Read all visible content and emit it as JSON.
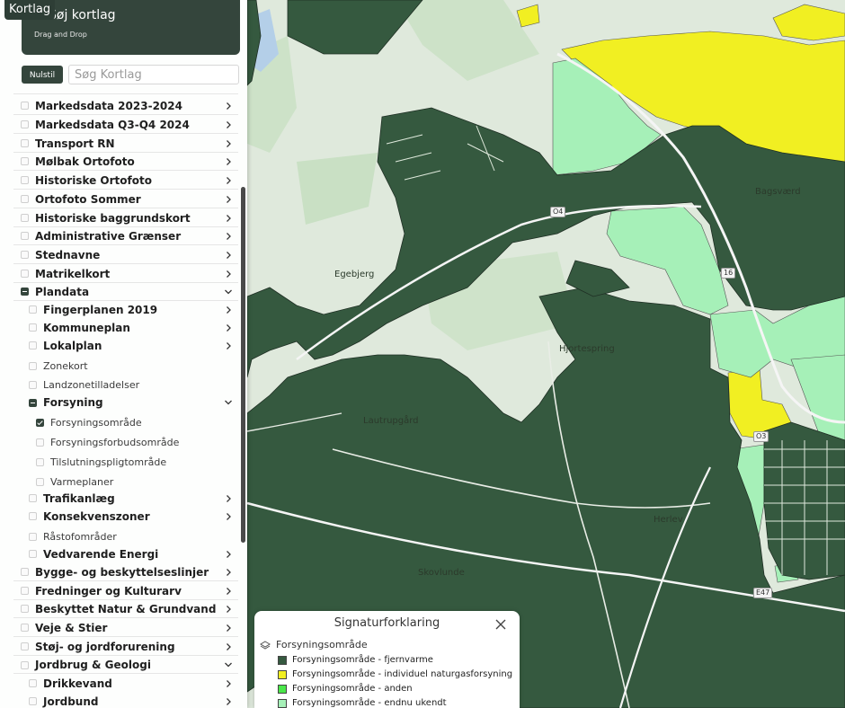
{
  "sidebar": {
    "tab_label": "Kortlag",
    "drop_title": "Søj kortlag",
    "drop_subtitle": "Drag and Drop",
    "reset_label": "Nulstil",
    "search_placeholder": "Søg Kortlag",
    "items": [
      {
        "label": "Markedsdata 2023-2024",
        "level": 1,
        "state": "unchecked",
        "chevron": "right"
      },
      {
        "label": "Markedsdata Q3-Q4 2024",
        "level": 1,
        "state": "unchecked",
        "chevron": "right"
      },
      {
        "label": "Transport RN",
        "level": 1,
        "state": "unchecked",
        "chevron": "right"
      },
      {
        "label": "Mølbak Ortofoto",
        "level": 1,
        "state": "unchecked",
        "chevron": "right"
      },
      {
        "label": "Historiske Ortofoto",
        "level": 1,
        "state": "unchecked",
        "chevron": "right"
      },
      {
        "label": "Ortofoto Sommer",
        "level": 1,
        "state": "unchecked",
        "chevron": "right"
      },
      {
        "label": "Historiske baggrundskort",
        "level": 1,
        "state": "unchecked",
        "chevron": "right"
      },
      {
        "label": "Administrative Grænser",
        "level": 1,
        "state": "unchecked",
        "chevron": "right"
      },
      {
        "label": "Stednavne",
        "level": 1,
        "state": "unchecked",
        "chevron": "right"
      },
      {
        "label": "Matrikelkort",
        "level": 1,
        "state": "unchecked",
        "chevron": "right"
      },
      {
        "label": "Plandata",
        "level": 1,
        "state": "partial",
        "chevron": "down"
      },
      {
        "label": "Fingerplanen 2019",
        "level": 2,
        "state": "unchecked",
        "chevron": "right"
      },
      {
        "label": "Kommuneplan",
        "level": 2,
        "state": "unchecked",
        "chevron": "right"
      },
      {
        "label": "Lokalplan",
        "level": 2,
        "state": "unchecked",
        "chevron": "right"
      },
      {
        "label": "Zonekort",
        "level": 2,
        "state": "unchecked",
        "chevron": "none"
      },
      {
        "label": "Landzonetilladelser",
        "level": 2,
        "state": "unchecked",
        "chevron": "none"
      },
      {
        "label": "Forsyning",
        "level": 2,
        "state": "partial",
        "chevron": "down"
      },
      {
        "label": "Forsyningsområde",
        "level": 3,
        "state": "checked",
        "chevron": "none"
      },
      {
        "label": "Forsyningsforbudsområde",
        "level": 3,
        "state": "unchecked",
        "chevron": "none"
      },
      {
        "label": "Tilslutningspligtområde",
        "level": 3,
        "state": "unchecked",
        "chevron": "none"
      },
      {
        "label": "Varmeplaner",
        "level": 3,
        "state": "unchecked",
        "chevron": "none"
      },
      {
        "label": "Trafikanlæg",
        "level": 2,
        "state": "unchecked",
        "chevron": "right"
      },
      {
        "label": "Konsekvenszoner",
        "level": 2,
        "state": "unchecked",
        "chevron": "right"
      },
      {
        "label": "Råstofområder",
        "level": 2,
        "state": "unchecked",
        "chevron": "none"
      },
      {
        "label": "Vedvarende Energi",
        "level": 2,
        "state": "unchecked",
        "chevron": "right"
      },
      {
        "label": "Bygge- og beskyttelseslinjer",
        "level": 1,
        "state": "unchecked",
        "chevron": "right"
      },
      {
        "label": "Fredninger og Kulturarv",
        "level": 1,
        "state": "unchecked",
        "chevron": "right"
      },
      {
        "label": "Beskyttet Natur & Grundvand",
        "level": 1,
        "state": "unchecked",
        "chevron": "right"
      },
      {
        "label": "Veje & Stier",
        "level": 1,
        "state": "unchecked",
        "chevron": "right"
      },
      {
        "label": "Støj- og jordforurening",
        "level": 1,
        "state": "unchecked",
        "chevron": "right"
      },
      {
        "label": "Jordbrug & Geologi",
        "level": 1,
        "state": "unchecked",
        "chevron": "down"
      },
      {
        "label": "Drikkevand",
        "level": 2,
        "state": "unchecked",
        "chevron": "right"
      },
      {
        "label": "Jordbund",
        "level": 2,
        "state": "unchecked",
        "chevron": "right"
      }
    ]
  },
  "map": {
    "place_labels": [
      "Egebjerg",
      "Hjortespring",
      "Lautrupgård",
      "Herlev",
      "Skovlunde",
      "Bagsværd"
    ],
    "road_labels": [
      "O4",
      "O3",
      "16",
      "E47"
    ],
    "colors": {
      "fjernvarme": "#35593f",
      "naturgas": "#f1ef22",
      "anden": "#4ae74a",
      "ukendt": "#a6f0b8",
      "background": "#dfe9dc",
      "water": "#b4cfe8"
    }
  },
  "legend": {
    "title": "Signaturforklaring",
    "group_label": "Forsyningsområde",
    "items": [
      {
        "label": "Forsyningsområde - fjernvarme",
        "color": "#35593f"
      },
      {
        "label": "Forsyningsområde - individuel naturgasforsyning",
        "color": "#f1ef22"
      },
      {
        "label": "Forsyningsområde - anden",
        "color": "#4ae74a"
      },
      {
        "label": "Forsyningsområde - endnu ukendt",
        "color": "#a6f0b8"
      }
    ]
  }
}
